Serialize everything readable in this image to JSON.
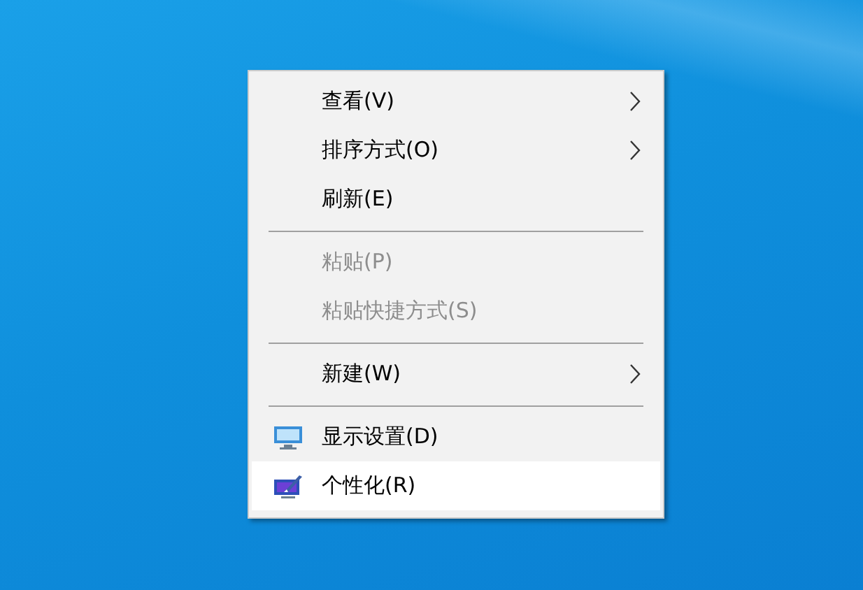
{
  "context_menu": {
    "items": [
      {
        "kind": "item",
        "label": "查看(V)",
        "submenu": true,
        "disabled": false,
        "selected": false
      },
      {
        "kind": "item",
        "label": "排序方式(O)",
        "submenu": true,
        "disabled": false,
        "selected": false
      },
      {
        "kind": "item",
        "label": "刷新(E)",
        "submenu": false,
        "disabled": false,
        "selected": false
      },
      {
        "kind": "separator"
      },
      {
        "kind": "item",
        "label": "粘贴(P)",
        "submenu": false,
        "disabled": true,
        "selected": false
      },
      {
        "kind": "item",
        "label": "粘贴快捷方式(S)",
        "submenu": false,
        "disabled": true,
        "selected": false
      },
      {
        "kind": "separator"
      },
      {
        "kind": "item",
        "label": "新建(W)",
        "submenu": true,
        "disabled": false,
        "selected": false
      },
      {
        "kind": "separator"
      },
      {
        "kind": "display",
        "label": "显示设置(D)",
        "submenu": false,
        "disabled": false,
        "selected": false
      },
      {
        "kind": "personalize",
        "label": "个性化(R)",
        "submenu": false,
        "disabled": false,
        "selected": true
      }
    ]
  }
}
